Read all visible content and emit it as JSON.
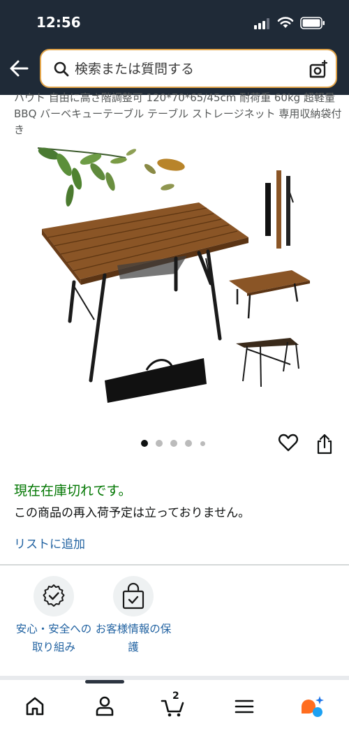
{
  "status_bar": {
    "time": "12:56"
  },
  "search": {
    "placeholder": "検索または質問する"
  },
  "product": {
    "title": "ハウト 自由に高さ階調整可 120*70*65/45cm 耐荷重 60kg 超軽量 BBQ バーベキューテーブル テーブル ストレージネット 専用収納袋付き",
    "image_count": 5,
    "active_image_index": 0
  },
  "availability": {
    "status": "現在在庫切れです。",
    "restock": "この商品の再入荷予定は立っておりません。",
    "add_to_list": "リストに追加"
  },
  "trust": [
    {
      "label": "安心・安全への取り組み",
      "icon": "shield-check-icon"
    },
    {
      "label": "お客様情報の保護",
      "icon": "lock-bag-icon"
    }
  ],
  "nav": {
    "cart_count": "2",
    "items": [
      "home-icon",
      "account-icon",
      "cart-icon",
      "menu-icon",
      "rufus-icon"
    ]
  },
  "colors": {
    "header_bg": "#1f2a37",
    "search_border": "#e3a54a",
    "in_stock_green": "#007600",
    "link_blue": "#2162a1"
  }
}
